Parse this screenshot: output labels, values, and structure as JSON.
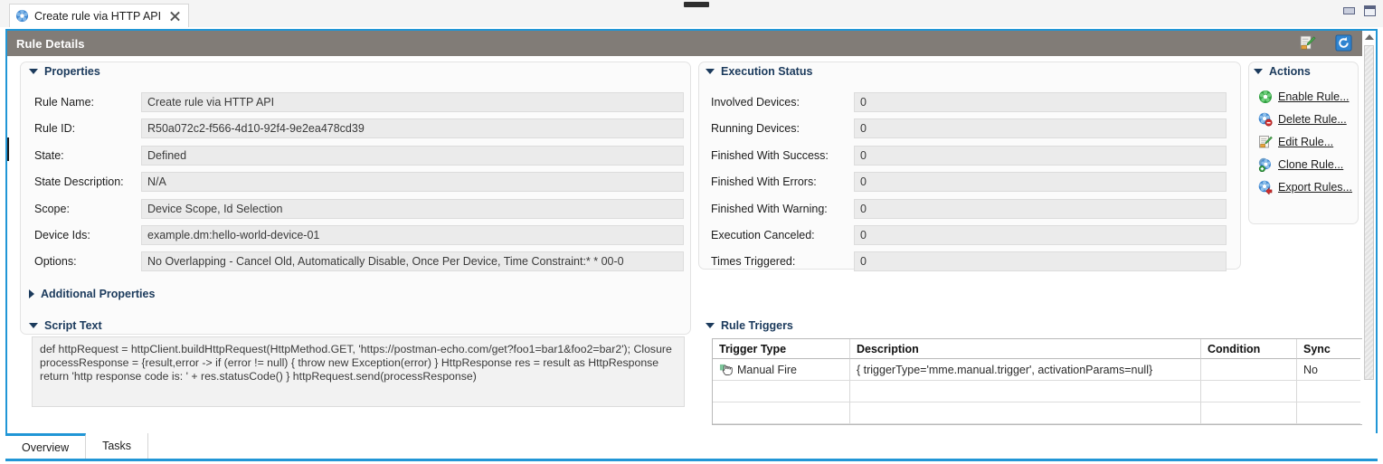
{
  "window": {
    "tab_title": "Create rule via HTTP API",
    "tab_icon": "rule-gear-icon",
    "close_icon": "close-icon",
    "minimize_icon": "minimize-icon",
    "maximize_icon": "maximize-icon"
  },
  "view": {
    "title": "Rule Details",
    "header_bg": "#817c77",
    "accent": "#2196d6",
    "toolbar": [
      {
        "name": "edit-rule-icon",
        "icon": "edit-pencil-icon"
      },
      {
        "name": "refresh-icon",
        "icon": "refresh-icon"
      }
    ]
  },
  "properties": {
    "heading": "Properties",
    "expanded": true,
    "fields": [
      {
        "label": "Rule Name:",
        "value": "Create rule via HTTP API"
      },
      {
        "label": "Rule ID:",
        "value": "R50a072c2-f566-4d10-92f4-9e2ea478cd39"
      },
      {
        "label": "State:",
        "value": "Defined"
      },
      {
        "label": "State Description:",
        "value": "N/A"
      },
      {
        "label": "Scope:",
        "value": "Device Scope, Id Selection"
      },
      {
        "label": "Device Ids:",
        "value": "example.dm:hello-world-device-01"
      },
      {
        "label": "Options:",
        "value": "No Overlapping - Cancel Old, Automatically Disable, Once Per Device, Time Constraint:* * 00-0"
      }
    ]
  },
  "additional_properties": {
    "heading": "Additional Properties",
    "expanded": false
  },
  "script_text": {
    "heading": "Script Text",
    "expanded": true,
    "value": "def httpRequest = httpClient.buildHttpRequest(HttpMethod.GET, 'https://postman-echo.com/get?foo1=bar1&foo2=bar2'); Closure processResponse = {result,error -> if (error != null) { throw new Exception(error) } HttpResponse res = result as HttpResponse return 'http response code is: ' + res.statusCode() } httpRequest.send(processResponse)"
  },
  "execution_status": {
    "heading": "Execution Status",
    "expanded": true,
    "fields": [
      {
        "label": "Involved Devices:",
        "value": "0"
      },
      {
        "label": "Running Devices:",
        "value": "0"
      },
      {
        "label": "Finished With Success:",
        "value": "0"
      },
      {
        "label": "Finished With Errors:",
        "value": "0"
      },
      {
        "label": "Finished With Warning:",
        "value": "0"
      },
      {
        "label": "Execution Canceled:",
        "value": "0"
      },
      {
        "label": "Times Triggered:",
        "value": "0"
      }
    ]
  },
  "rule_triggers": {
    "heading": "Rule Triggers",
    "expanded": true,
    "columns": [
      "Trigger Type",
      "Description",
      "Condition",
      "Sync"
    ],
    "rows": [
      {
        "icon": "manual-fire-hand-icon",
        "trigger_type": "Manual Fire",
        "description": "{ triggerType='mme.manual.trigger', activationParams=null}",
        "condition": "",
        "sync": "No"
      },
      {
        "icon": "",
        "trigger_type": "",
        "description": "",
        "condition": "",
        "sync": ""
      },
      {
        "icon": "",
        "trigger_type": "",
        "description": "",
        "condition": "",
        "sync": ""
      }
    ]
  },
  "actions": {
    "heading": "Actions",
    "expanded": true,
    "items": [
      {
        "label": "Enable Rule...",
        "icon": "enable-rule-icon"
      },
      {
        "label": "Delete Rule...",
        "icon": "delete-rule-icon"
      },
      {
        "label": "Edit Rule...",
        "icon": "edit-rule-icon"
      },
      {
        "label": "Clone Rule...",
        "icon": "clone-rule-icon"
      },
      {
        "label": "Export Rules...",
        "icon": "export-rules-icon"
      }
    ]
  },
  "bottom_tabs": {
    "items": [
      {
        "label": "Overview",
        "active": true
      },
      {
        "label": "Tasks",
        "active": false
      }
    ]
  }
}
